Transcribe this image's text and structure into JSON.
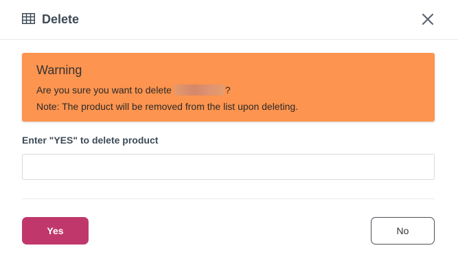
{
  "dialog": {
    "title": "Delete",
    "title_icon": "table-icon",
    "close_icon": "close-icon"
  },
  "warning": {
    "title": "Warning",
    "message_prefix": "Are you sure you want to delete",
    "message_suffix": "?",
    "note": "Note: The product will be removed from the list upon deleting.",
    "background_color": "#fd944f"
  },
  "confirm": {
    "label": "Enter \"YES\" to delete product",
    "value": "",
    "placeholder": ""
  },
  "actions": {
    "yes_label": "Yes",
    "no_label": "No",
    "yes_color": "#c0386b"
  }
}
